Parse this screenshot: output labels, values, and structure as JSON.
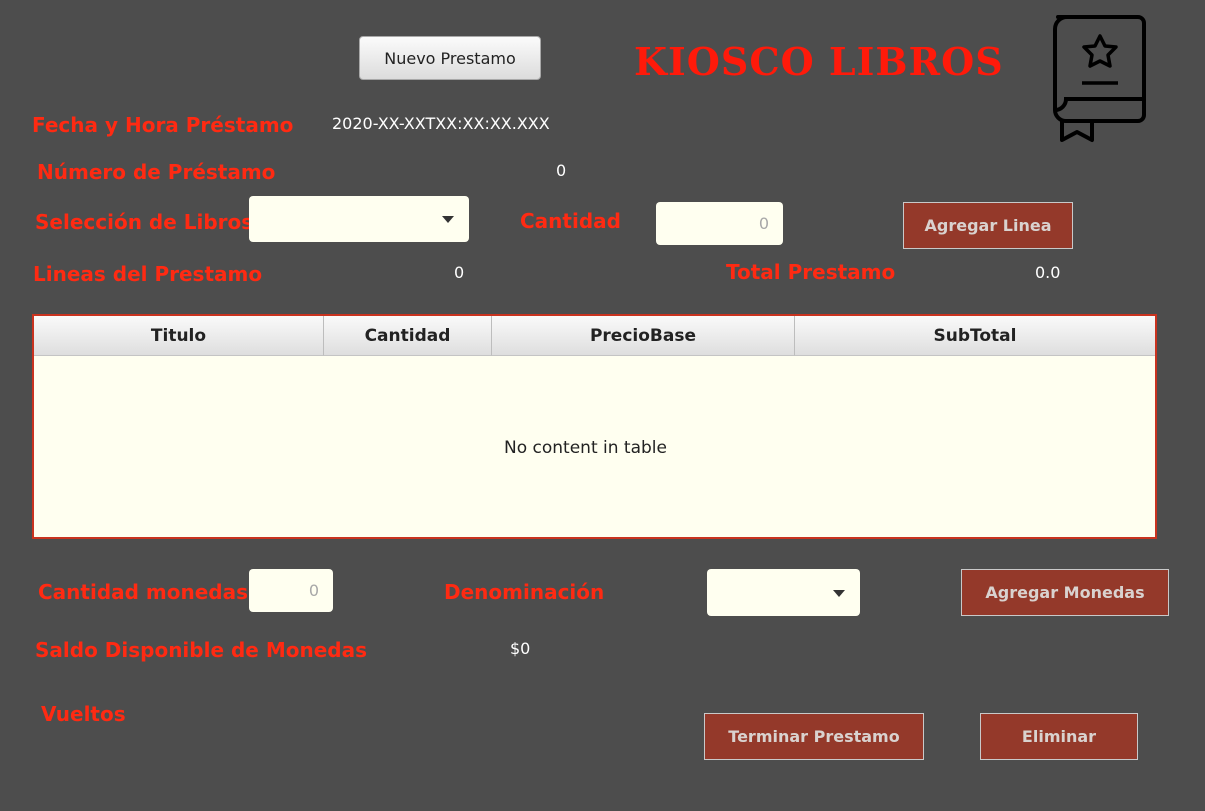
{
  "header": {
    "new_loan_button": "Nuevo Prestamo",
    "title": "KIOSCO LIBROS",
    "logo_icon": "book-star-icon"
  },
  "loan_info": {
    "datetime_label": "Fecha y Hora Préstamo",
    "datetime_value": "2020-XX-XXTXX:XX:XX.XXX",
    "number_label": "Número de Préstamo",
    "number_value": "0",
    "book_selection_label": "Selección de Libros",
    "book_selection_value": "",
    "quantity_label": "Cantidad",
    "quantity_placeholder": "0",
    "add_line_button": "Agregar Linea",
    "lines_label": "Lineas del Prestamo",
    "lines_value": "0",
    "total_label": "Total Prestamo",
    "total_value": "0.0"
  },
  "table": {
    "columns": [
      "Titulo",
      "Cantidad",
      "PrecioBase",
      "SubTotal"
    ],
    "rows": [],
    "empty_message": "No content in table"
  },
  "coins": {
    "quantity_label": "Cantidad monedas",
    "quantity_placeholder": "0",
    "denomination_label": "Denominación",
    "denomination_value": "",
    "add_coins_button": "Agregar Monedas",
    "balance_label": "Saldo Disponible  de Monedas",
    "balance_value": "$0",
    "change_label": "Vueltos"
  },
  "actions": {
    "finish_button": "Terminar Prestamo",
    "delete_button": "Eliminar"
  },
  "colors": {
    "background": "#4d4d4d",
    "label_red": "#ff2a12",
    "button_red": "#94392a",
    "input_bg": "#fffff0"
  }
}
